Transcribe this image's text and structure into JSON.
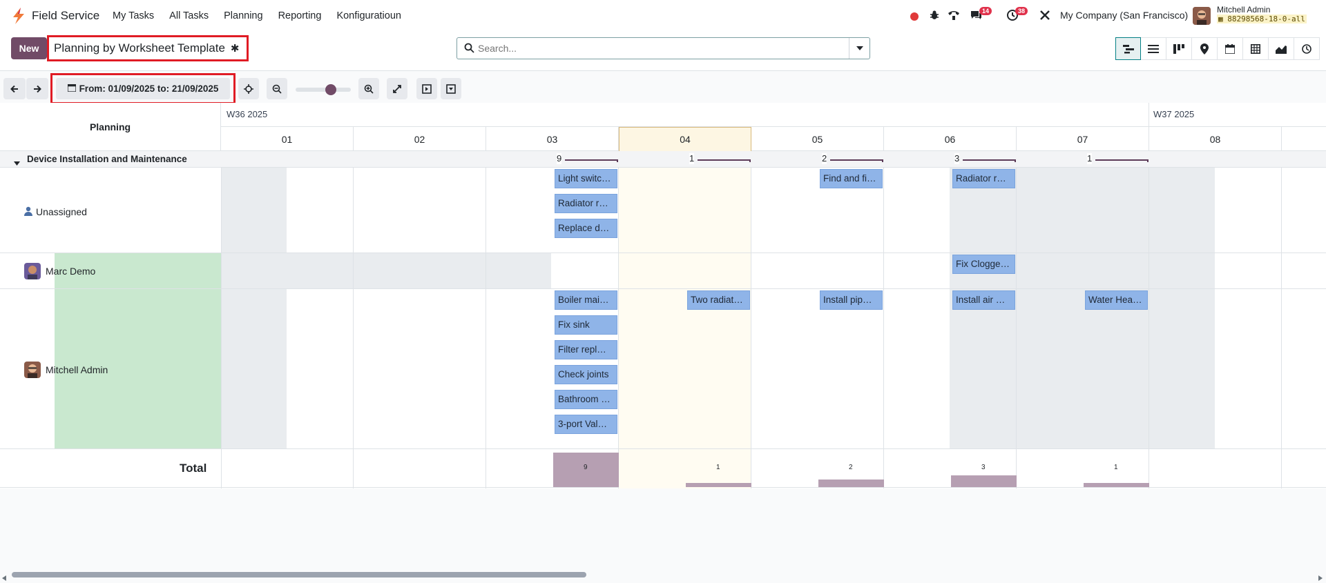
{
  "app": {
    "name": "Field Service"
  },
  "menu": [
    "My Tasks",
    "All Tasks",
    "Planning",
    "Reporting",
    "Konfiguratioun"
  ],
  "systray": {
    "messages_count": "14",
    "activities_count": "38",
    "company": "My Company (San Francisco)",
    "user_name": "Mitchell Admin",
    "db_name": "88298568-18-0-all"
  },
  "control": {
    "new_label": "New",
    "view_title": "Planning by Worksheet Template",
    "search_placeholder": "Search..."
  },
  "gantt_toolbar": {
    "range_label": "From: 01/09/2025 to: 21/09/2025"
  },
  "gantt": {
    "header_label": "Planning",
    "weeks": [
      "W36 2025",
      "W37 2025"
    ],
    "days": [
      "01",
      "02",
      "03",
      "04",
      "05",
      "06",
      "07",
      "08"
    ],
    "group": {
      "label": "Device Installation and Maintenance",
      "counts": [
        "9",
        "1",
        "2",
        "3",
        "1"
      ]
    },
    "rows": [
      {
        "label": "Unassigned",
        "tasks": [
          "Light switc…",
          "Radiator r…",
          "Replace d…",
          "Find and fi…",
          "Radiator r…"
        ]
      },
      {
        "label": "Marc Demo",
        "tasks": [
          "Fix Clogge…"
        ]
      },
      {
        "label": "Mitchell Admin",
        "tasks": [
          "Boiler mai…",
          "Fix sink",
          "Filter repl…",
          "Check joints",
          "Bathroom …",
          "3-port Val…",
          "Two radiat…",
          "Install pip…",
          "Install air …",
          "Water Hea…"
        ]
      }
    ],
    "total": {
      "label": "Total",
      "values": [
        "9",
        "1",
        "2",
        "3",
        "1"
      ]
    }
  },
  "colors": {
    "brand": "#714b67",
    "task": "#8fb4e8",
    "highlight": "#e01b24"
  }
}
